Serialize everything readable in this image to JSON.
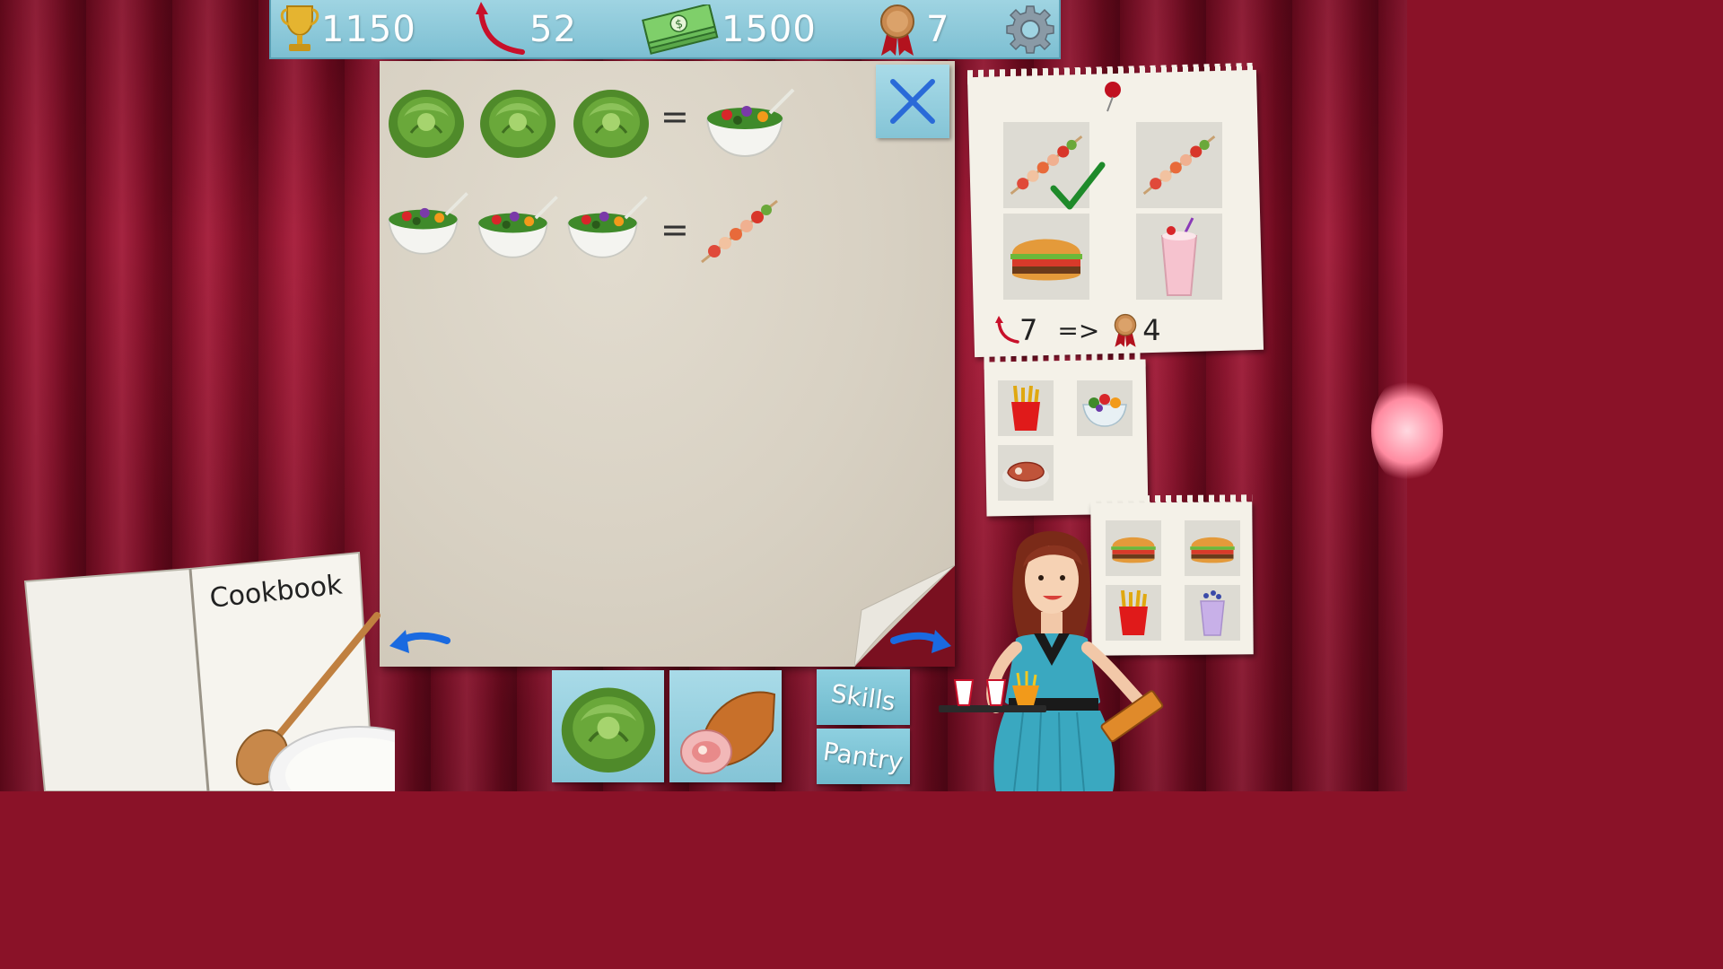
{
  "hud": {
    "trophy_score": "1150",
    "experience": "52",
    "money": "1500",
    "medals": "7"
  },
  "icons": {
    "trophy": "trophy-icon",
    "experience": "red-arrow-icon",
    "money": "cash-stack-icon",
    "medal": "medal-icon",
    "settings": "gear-icon",
    "close": "close-x-icon",
    "prev": "left-arrow-icon",
    "next": "right-arrow-icon"
  },
  "recipes": [
    {
      "inputs": [
        "lettuce",
        "lettuce",
        "lettuce"
      ],
      "equals": "=",
      "output": "salad"
    },
    {
      "inputs": [
        "salad",
        "salad",
        "salad"
      ],
      "equals": "=",
      "output": "kebab"
    }
  ],
  "orders": {
    "main": {
      "items": [
        "kebab",
        "kebab",
        "burger",
        "milkshake"
      ],
      "completed": [
        true,
        false,
        false,
        false
      ],
      "reward": {
        "experience": "7",
        "arrow": "=>",
        "medals": "4"
      }
    },
    "second": {
      "items": [
        "fries",
        "salad-bowl",
        "steak"
      ]
    },
    "third": {
      "items": [
        "burger",
        "burger",
        "fries",
        "purple-drink"
      ]
    }
  },
  "ingredients": [
    "lettuce",
    "ham"
  ],
  "menu": {
    "skills": "Skills",
    "pantry": "Pantry"
  },
  "cookbook": {
    "title": "Cookbook"
  },
  "colors": {
    "accent": "#84c4d6",
    "curtain": "#8e1630",
    "paper": "#d8d1c3"
  }
}
